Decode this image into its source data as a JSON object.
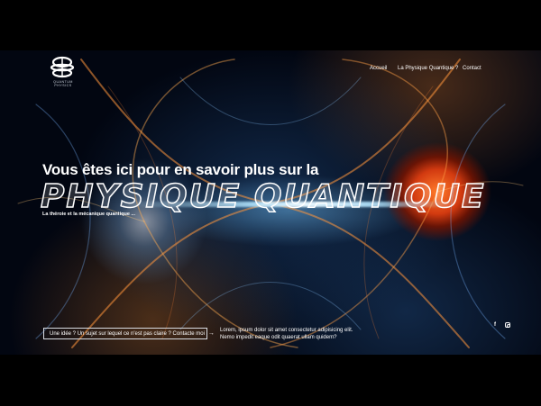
{
  "brand": {
    "caption": "QUANTUM PHYSICS"
  },
  "nav": {
    "items": [
      {
        "label": "Accueil"
      },
      {
        "label": "La Physique Quantique ?"
      },
      {
        "label": "Contact"
      }
    ]
  },
  "hero": {
    "headline": "Vous êtes ici pour en savoir plus sur la",
    "title": "PHYSIQUE QUANTIQUE",
    "subtitle": "La théroie et la mécanique quantique ..."
  },
  "cta": {
    "label": "Une idée ? Un sujet sur lequel ce n'est pas claire ? Contacte moi",
    "arrow": "→"
  },
  "description": {
    "line1": "Lorem, ipsum dolor sit amet consectetur adipisicing elit.",
    "line2": "Nemo impedit eaque odit quaerat ullam quidem?"
  },
  "social": {
    "facebook_glyph": "f",
    "icons": [
      "facebook-icon",
      "instagram-icon"
    ]
  },
  "colors": {
    "background": "#000000",
    "text": "#ffffff",
    "accent_orange": "#d23a10",
    "accent_blue": "#78c8ff"
  }
}
